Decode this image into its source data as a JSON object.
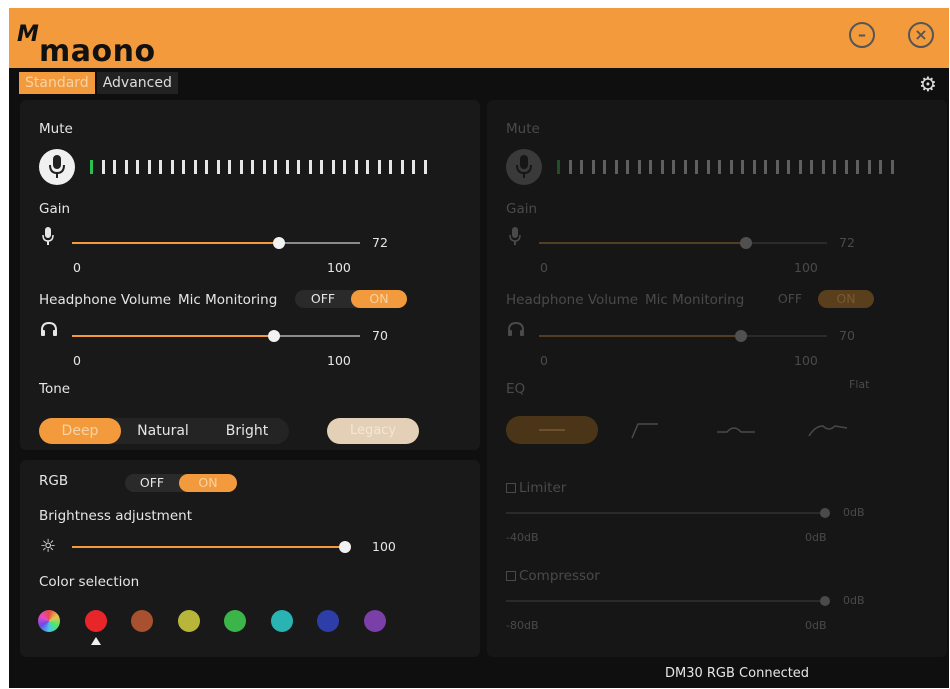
{
  "app": {
    "logo_mark": "M",
    "logo_text": "maono"
  },
  "window": {
    "minimize_glyph": "–",
    "close_glyph": "×"
  },
  "tabs": [
    {
      "label": "Standard",
      "active": true
    },
    {
      "label": "Advanced",
      "active": false
    }
  ],
  "left": {
    "mute": {
      "label": "Mute",
      "meter_green": 1,
      "meter_total": 30
    },
    "gain": {
      "label": "Gain",
      "value": "72",
      "min": "0",
      "max": "100",
      "level": 0.72
    },
    "headphone": {
      "label": "Headphone Volume",
      "value": "70",
      "min": "0",
      "max": "100",
      "level": 0.7
    },
    "monitoring": {
      "label": "Mic Monitoring",
      "off": "OFF",
      "on": "ON",
      "state": "ON"
    },
    "tone": {
      "label": "Tone",
      "options": [
        "Deep",
        "Natural",
        "Bright"
      ],
      "selected": "Deep",
      "legacy": "Legacy"
    }
  },
  "rgb": {
    "label": "RGB",
    "off": "OFF",
    "on": "ON",
    "state": "ON",
    "brightness": {
      "label": "Brightness adjustment",
      "value": "100",
      "level": 1.0
    },
    "color_label": "Color selection",
    "colors": [
      "#c0c0c0",
      "#e8262a",
      "#a8502f",
      "#b8b63a",
      "#3bb54a",
      "#2ab3b3",
      "#2d3ea8",
      "#7b3fa8"
    ],
    "selected_index": 1
  },
  "right": {
    "mute": {
      "label": "Mute",
      "meter_green": 1,
      "meter_total": 30
    },
    "gain": {
      "label": "Gain",
      "value": "72",
      "min": "0",
      "max": "100",
      "level": 0.72
    },
    "headphone": {
      "label": "Headphone Volume",
      "value": "70",
      "min": "0",
      "max": "100",
      "level": 0.7
    },
    "monitoring": {
      "label": "Mic Monitoring",
      "off": "OFF",
      "on": "ON",
      "state": "ON"
    },
    "eq": {
      "label": "EQ",
      "preset": "Flat"
    },
    "limiter": {
      "label": "Limiter",
      "value": "0dB",
      "min": "-40dB",
      "max": "0dB",
      "level": 1.0
    },
    "compressor": {
      "label": "Compressor",
      "value": "0dB",
      "min": "-80dB",
      "max": "0dB",
      "level": 1.0
    }
  },
  "status": {
    "text": "DM30 RGB Connected"
  },
  "colors": {
    "accent": "#f39b3c",
    "titlebar": "#f39b3c",
    "background": "#0f0f0f",
    "panel": "#191919"
  }
}
